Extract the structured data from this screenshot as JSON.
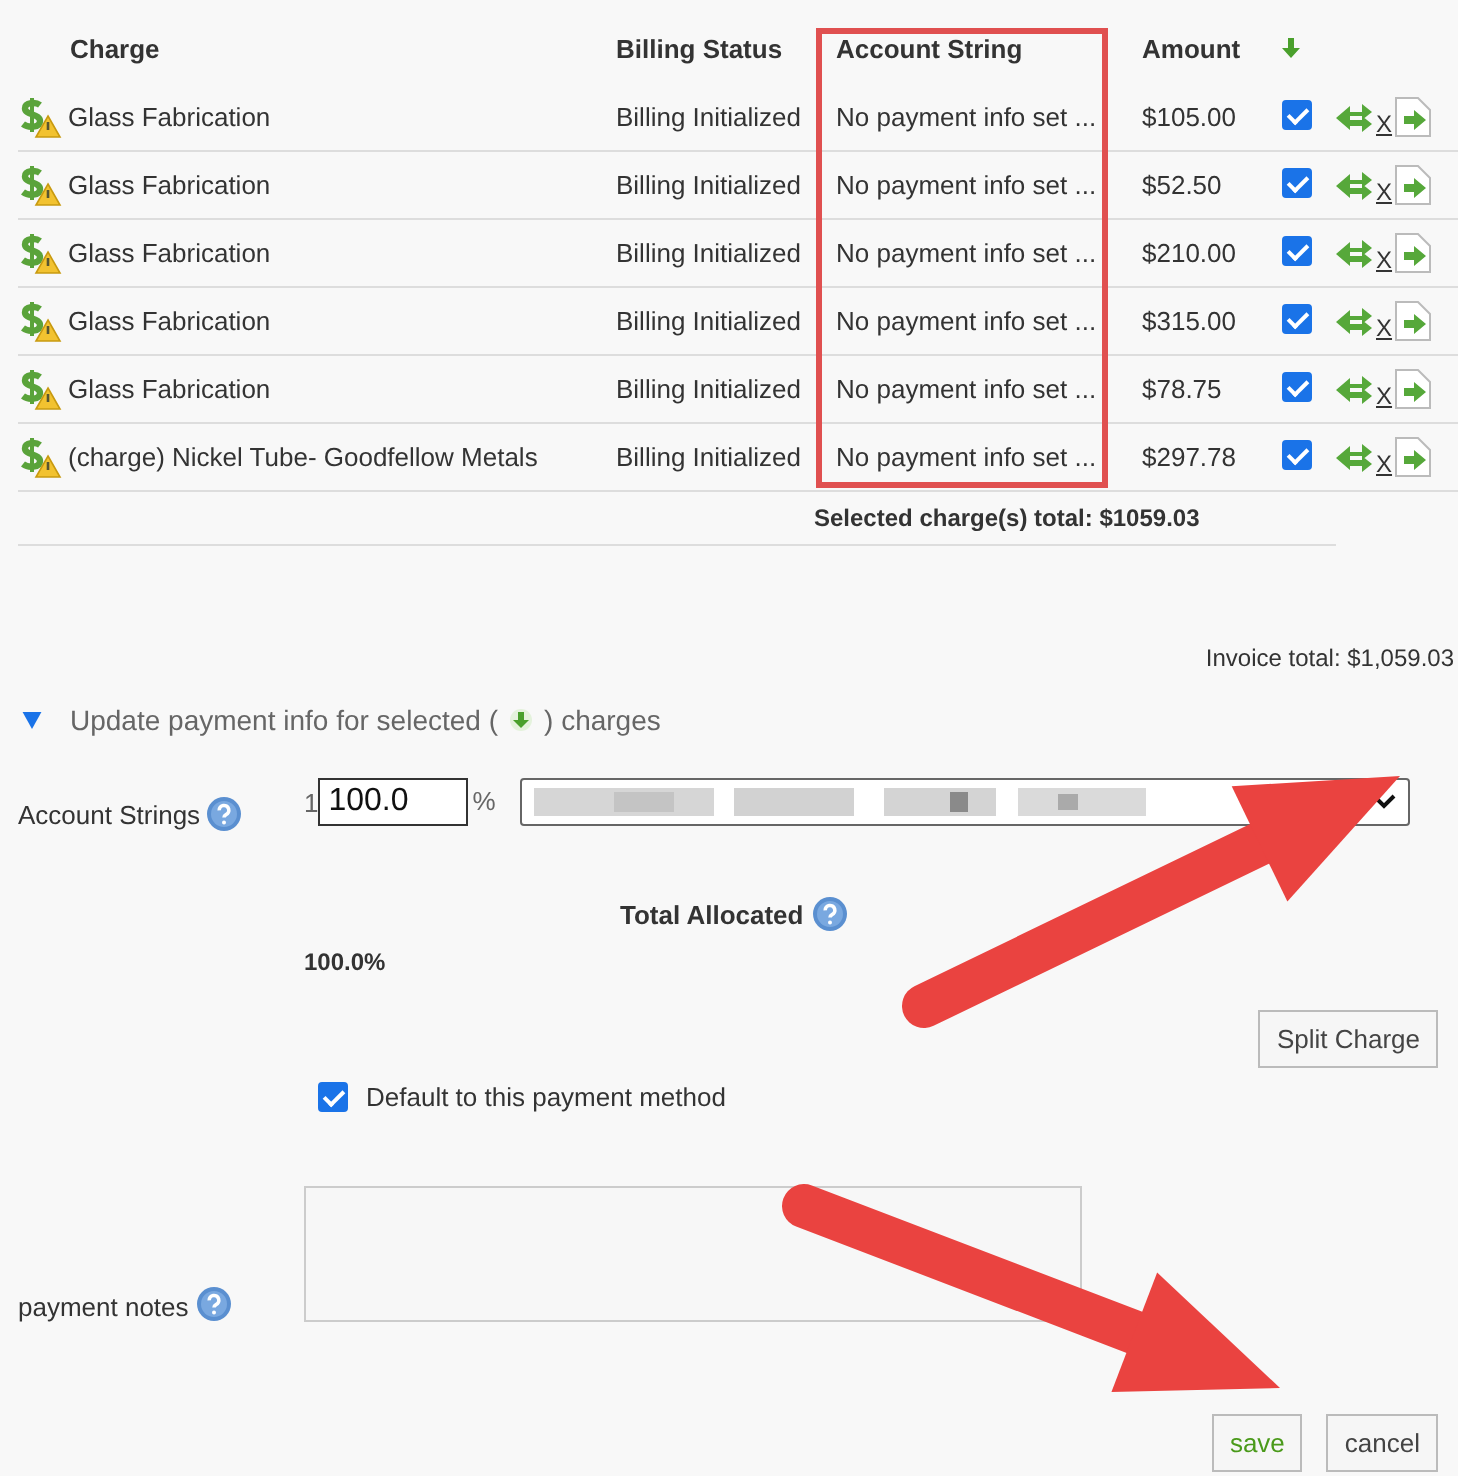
{
  "table": {
    "columns": [
      "Charge",
      "Billing Status",
      "Account String",
      "Amount"
    ],
    "rows": [
      {
        "charge": "Glass Fabrication",
        "status": "Billing Initialized",
        "account": "No payment info set ...",
        "amount": "$105.00",
        "selected": true,
        "remove": "X"
      },
      {
        "charge": "Glass Fabrication",
        "status": "Billing Initialized",
        "account": "No payment info set ...",
        "amount": "$52.50",
        "selected": true,
        "remove": "X"
      },
      {
        "charge": "Glass Fabrication",
        "status": "Billing Initialized",
        "account": "No payment info set ...",
        "amount": "$210.00",
        "selected": true,
        "remove": "X"
      },
      {
        "charge": "Glass Fabrication",
        "status": "Billing Initialized",
        "account": "No payment info set ...",
        "amount": "$315.00",
        "selected": true,
        "remove": "X"
      },
      {
        "charge": "Glass Fabrication",
        "status": "Billing Initialized",
        "account": "No payment info set ...",
        "amount": "$78.75",
        "selected": true,
        "remove": "X"
      },
      {
        "charge": "(charge) Nickel Tube- Goodfellow Metals",
        "status": "Billing Initialized",
        "account": "No payment info set ...",
        "amount": "$297.78",
        "selected": true,
        "remove": "X"
      }
    ],
    "selected_total": "Selected charge(s) total: $1059.03"
  },
  "invoice_total": "Invoice total: $1,059.03",
  "payment_section": {
    "expanded": true,
    "title_before": "Update payment info for selected (",
    "title_after": ") charges",
    "account_label": "Account Strings",
    "row_prefix": "1",
    "percent_value": "100.0",
    "percent_sign": "%",
    "total_label": "Total Allocated",
    "total_value": "100.0%",
    "split_button": "Split Charge",
    "default_label": "Default to this payment method",
    "default_checked": true,
    "notes_label": "payment notes"
  },
  "buttons": [
    {
      "label": "save",
      "kind": "primary"
    },
    {
      "label": "cancel",
      "kind": "secondary"
    }
  ]
}
